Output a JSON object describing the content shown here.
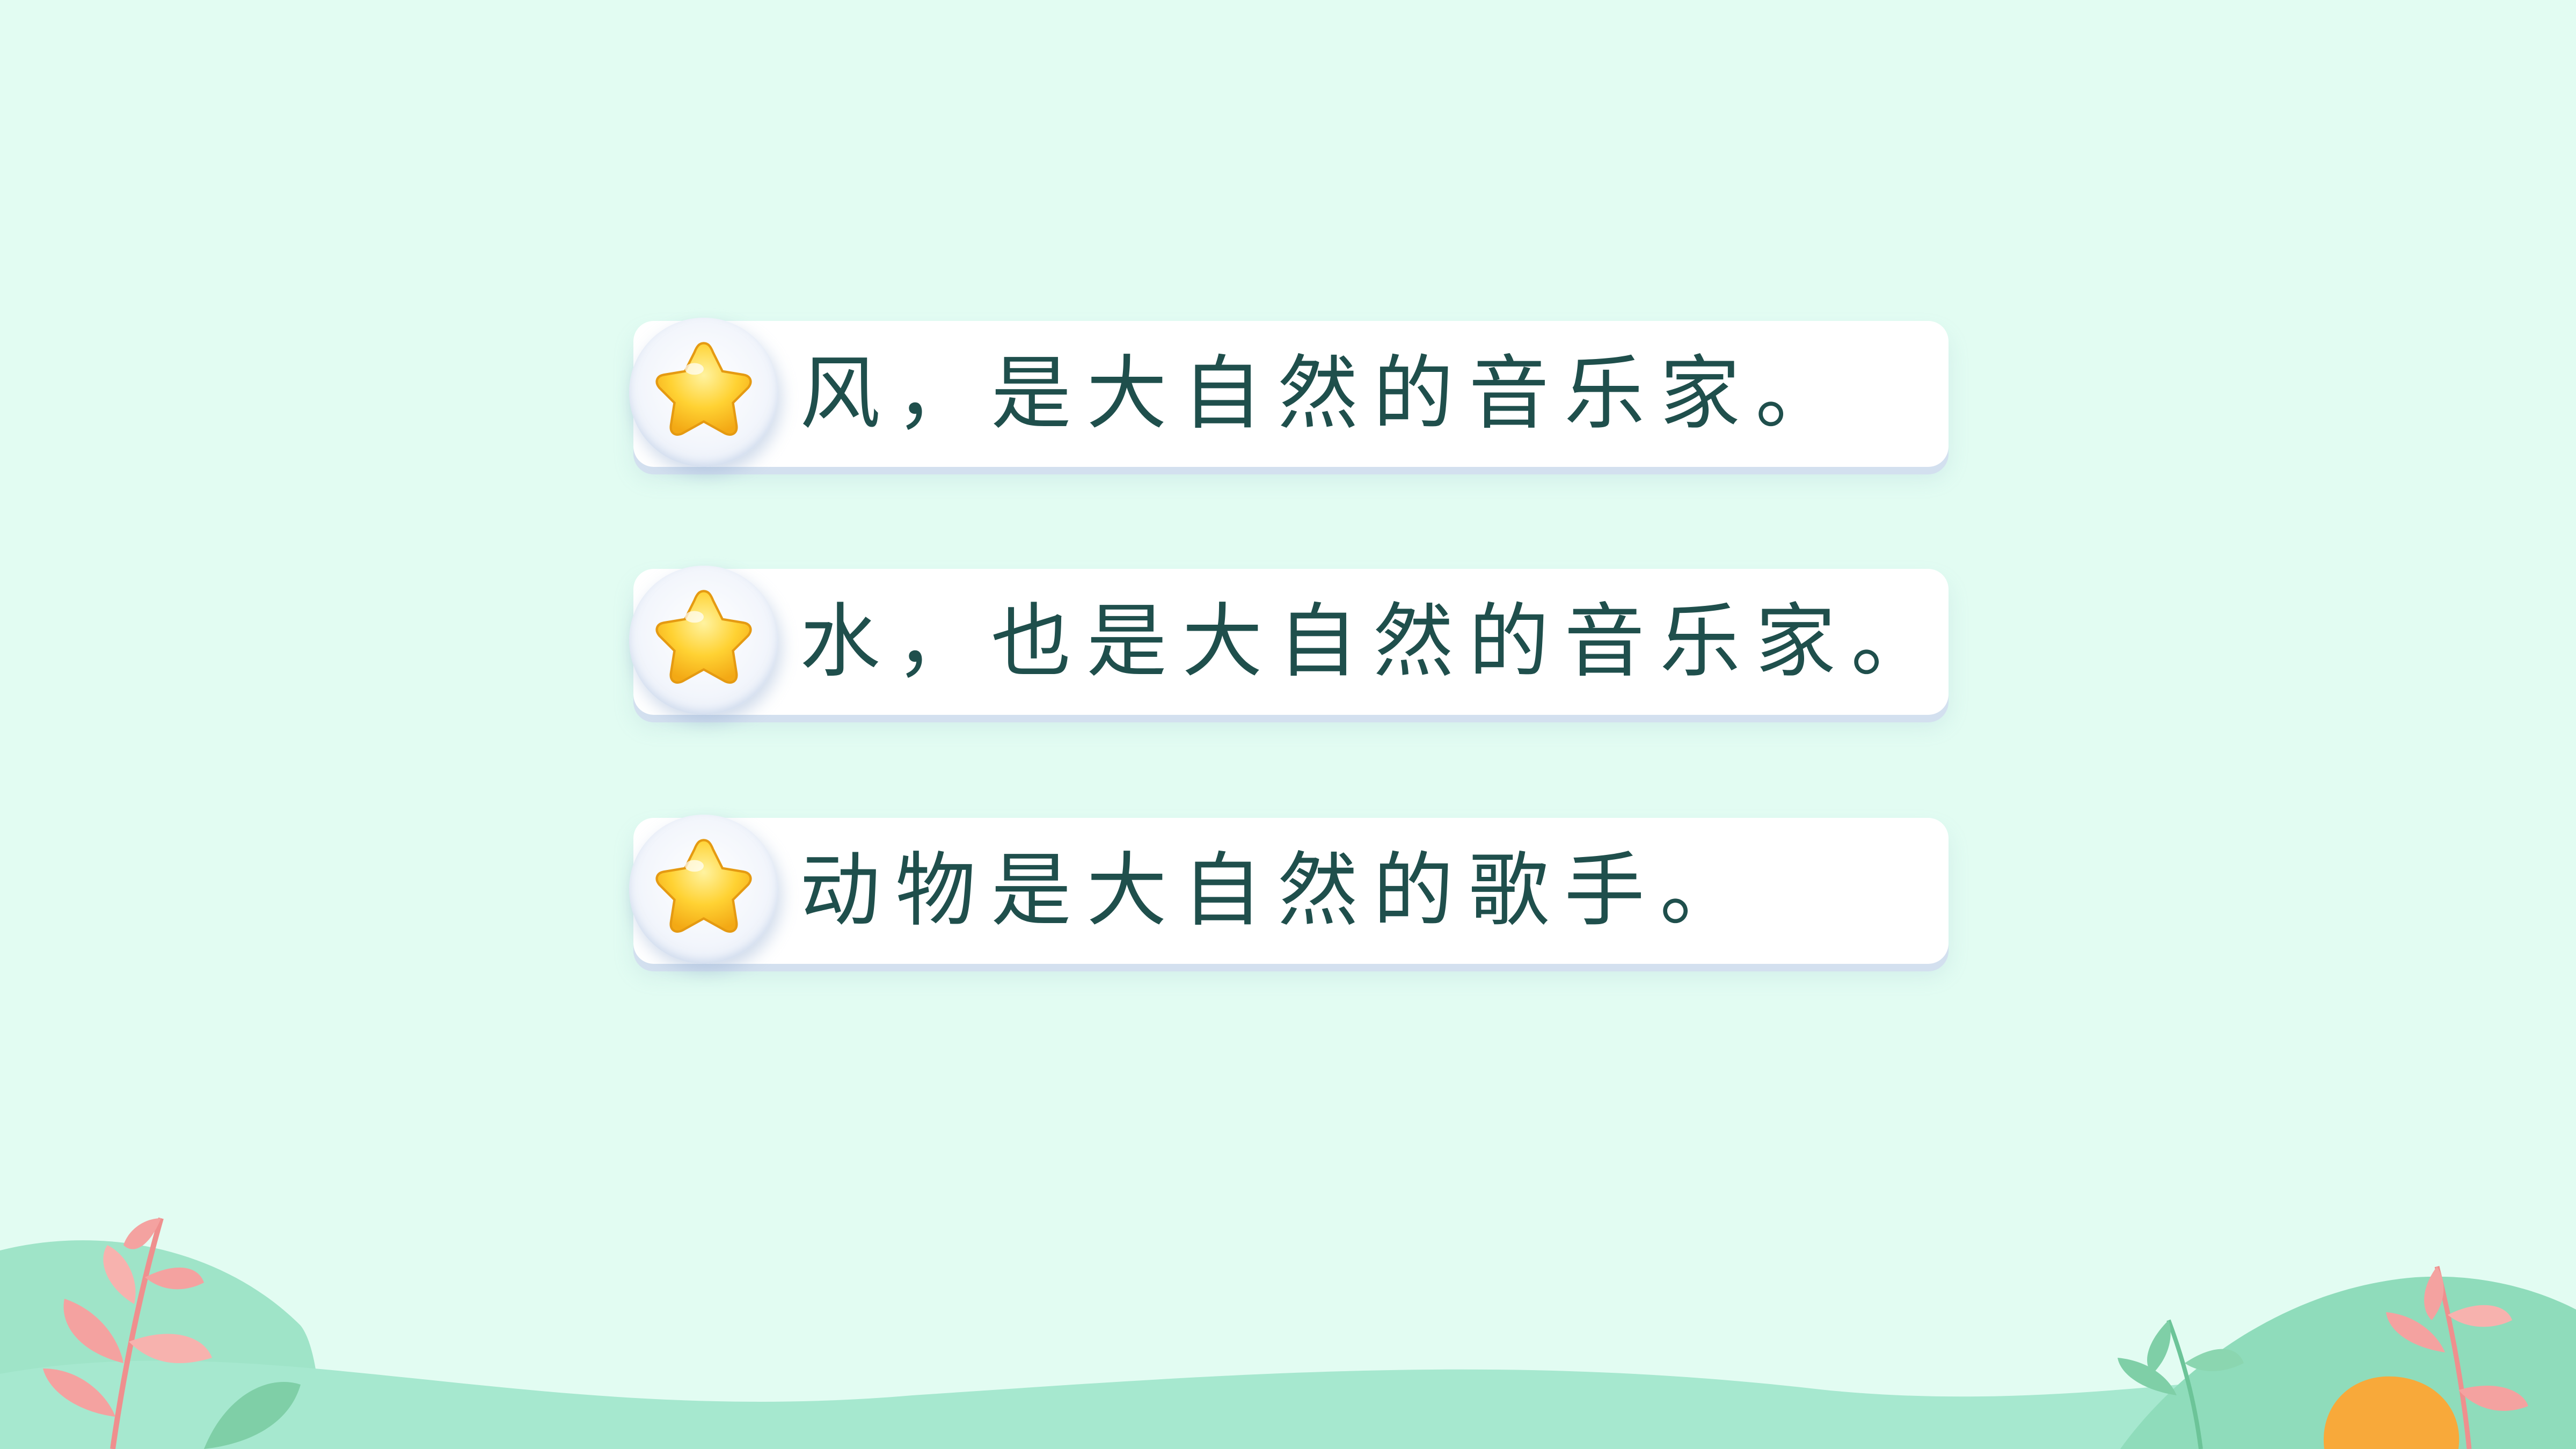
{
  "slide": {
    "lines": [
      {
        "text": "风，是大自然的音乐家。",
        "icon": "star-icon"
      },
      {
        "text": "水，也是大自然的音乐家。",
        "icon": "star-icon"
      },
      {
        "text": "动物是大自然的歌手。",
        "icon": "star-icon"
      }
    ]
  },
  "colors": {
    "background": "#e2fcf2",
    "text": "#1f4f4c",
    "card": "#ffffff",
    "star": "#ffc928",
    "leaf_pink": "#f4a2a0",
    "leaf_green": "#7fcfa7",
    "hill": "#a6e8cf",
    "orange": "#f8a93a"
  }
}
